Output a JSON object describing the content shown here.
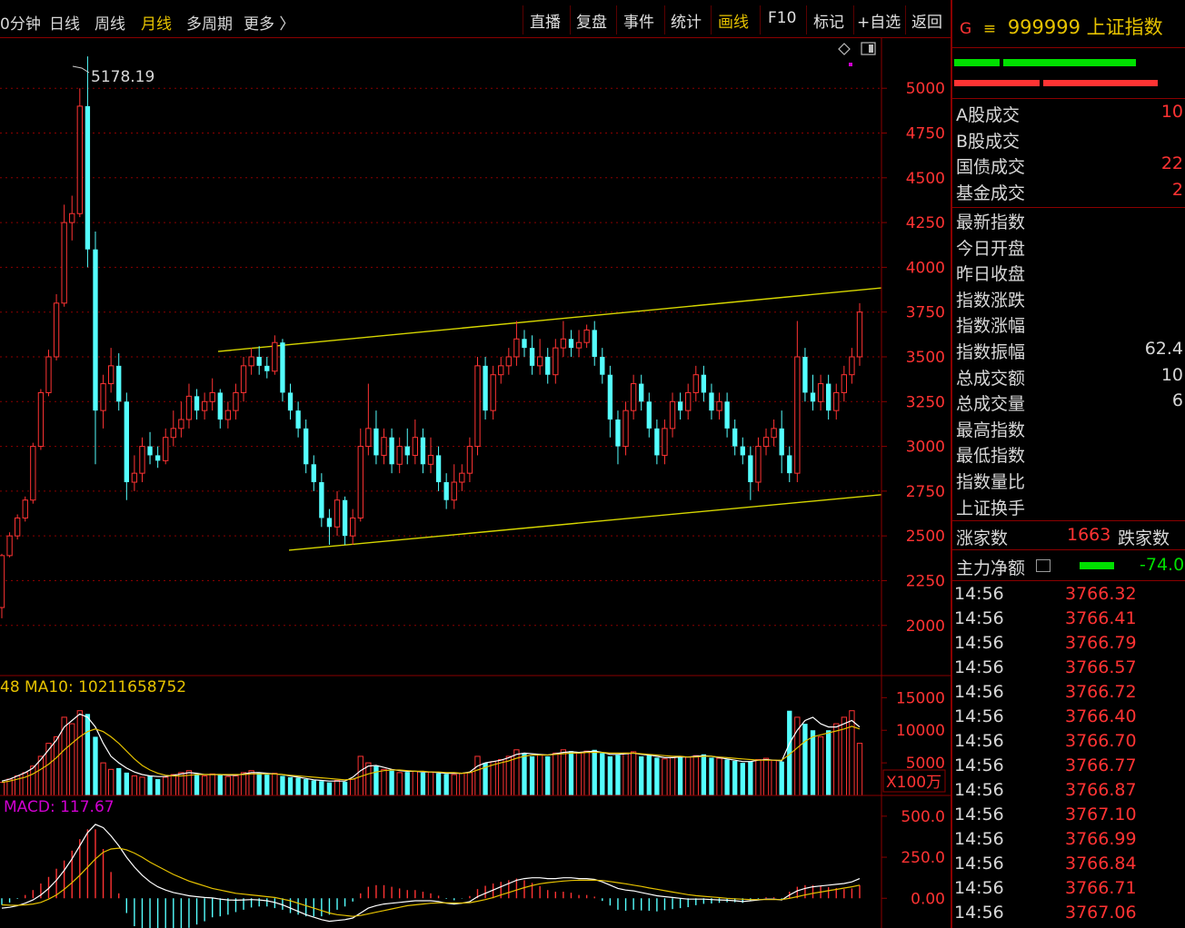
{
  "toolbar": {
    "periods": [
      "0分钟",
      "日线",
      "周线",
      "月线",
      "多周期",
      "更多 〉"
    ],
    "active_period": "月线",
    "tools": [
      "直播",
      "复盘",
      "事件",
      "统计",
      "画线",
      "F10",
      "标记",
      "+自选",
      "返回"
    ],
    "active_tool": "画线"
  },
  "colors": {
    "up": "#ff3333",
    "down": "#54ffff",
    "ma_white": "#ffffff",
    "ma_yellow": "#e6c200",
    "trend": "#d6d600",
    "grid": "#8b0000",
    "macd_label": "#d000d0"
  },
  "chart_data": {
    "type": "candlestick",
    "price_axis": {
      "ticks": [
        5000,
        4750,
        4500,
        4250,
        4000,
        3750,
        3500,
        3250,
        3000,
        2750,
        2500,
        2250,
        2000
      ],
      "range": [
        1730,
        5280
      ]
    },
    "max_label": "5178.19",
    "volume_label": "48  MA10: 10211658752",
    "volume_axis": {
      "ticks": [
        15000,
        10000,
        5000
      ],
      "unit": "X100万",
      "range": [
        0,
        17000
      ]
    },
    "macd_label": "MACD: 117.67",
    "macd_axis": {
      "ticks": [
        "500.0",
        "250.0",
        "0.00"
      ],
      "range": [
        -170,
        560
      ]
    },
    "candles": [
      [
        2100,
        2390,
        2040,
        2400
      ],
      [
        2390,
        2500,
        2380,
        2520
      ],
      [
        2500,
        2600,
        2480,
        2620
      ],
      [
        2600,
        2700,
        2580,
        2720
      ],
      [
        2700,
        3000,
        2680,
        3020
      ],
      [
        3000,
        3300,
        2980,
        3320
      ],
      [
        3300,
        3500,
        3280,
        3540
      ],
      [
        3500,
        3800,
        3480,
        3850
      ],
      [
        3800,
        4250,
        3780,
        4350
      ],
      [
        4250,
        4300,
        4150,
        4400
      ],
      [
        4300,
        4900,
        4280,
        5000
      ],
      [
        4900,
        4100,
        4000,
        5178.19
      ],
      [
        4100,
        3200,
        2900,
        4200
      ],
      [
        3200,
        3350,
        3100,
        3400
      ],
      [
        3350,
        3450,
        3300,
        3550
      ],
      [
        3450,
        3250,
        3200,
        3520
      ],
      [
        3250,
        2800,
        2700,
        3300
      ],
      [
        2800,
        2850,
        2750,
        2950
      ],
      [
        2850,
        3000,
        2800,
        3050
      ],
      [
        3000,
        2950,
        2900,
        3080
      ],
      [
        2950,
        2920,
        2880,
        3000
      ],
      [
        2920,
        3050,
        2900,
        3100
      ],
      [
        3050,
        3100,
        3000,
        3200
      ],
      [
        3100,
        3150,
        3050,
        3250
      ],
      [
        3150,
        3280,
        3100,
        3350
      ],
      [
        3280,
        3200,
        3150,
        3320
      ],
      [
        3200,
        3250,
        3150,
        3300
      ],
      [
        3250,
        3300,
        3200,
        3380
      ],
      [
        3300,
        3150,
        3100,
        3320
      ],
      [
        3150,
        3200,
        3100,
        3250
      ],
      [
        3200,
        3300,
        3150,
        3350
      ],
      [
        3300,
        3450,
        3250,
        3500
      ],
      [
        3450,
        3500,
        3400,
        3550
      ],
      [
        3500,
        3450,
        3400,
        3560
      ],
      [
        3450,
        3420,
        3380,
        3500
      ],
      [
        3420,
        3580,
        3400,
        3620
      ],
      [
        3580,
        3300,
        3250,
        3600
      ],
      [
        3300,
        3200,
        3150,
        3350
      ],
      [
        3200,
        3100,
        3050,
        3250
      ],
      [
        3100,
        2900,
        2850,
        3150
      ],
      [
        2900,
        2800,
        2750,
        2950
      ],
      [
        2800,
        2600,
        2550,
        2850
      ],
      [
        2600,
        2550,
        2450,
        2650
      ],
      [
        2550,
        2700,
        2500,
        2750
      ],
      [
        2700,
        2500,
        2450,
        2720
      ],
      [
        2500,
        2600,
        2450,
        2650
      ],
      [
        2600,
        3000,
        2580,
        3100
      ],
      [
        3000,
        3100,
        2950,
        3350
      ],
      [
        3100,
        2950,
        2900,
        3200
      ],
      [
        2950,
        3050,
        2900,
        3100
      ],
      [
        3050,
        2900,
        2850,
        3100
      ],
      [
        2900,
        3000,
        2850,
        3050
      ],
      [
        3000,
        2950,
        2900,
        3100
      ],
      [
        2950,
        3050,
        2900,
        3150
      ],
      [
        3050,
        2900,
        2850,
        3100
      ],
      [
        2900,
        2950,
        2850,
        3050
      ],
      [
        2950,
        2800,
        2750,
        3000
      ],
      [
        2800,
        2700,
        2650,
        2850
      ],
      [
        2700,
        2800,
        2650,
        2900
      ],
      [
        2800,
        2850,
        2750,
        2900
      ],
      [
        2850,
        3000,
        2800,
        3050
      ],
      [
        3000,
        3450,
        2950,
        3500
      ],
      [
        3450,
        3200,
        3150,
        3500
      ],
      [
        3200,
        3400,
        3150,
        3450
      ],
      [
        3400,
        3450,
        3350,
        3500
      ],
      [
        3450,
        3500,
        3400,
        3550
      ],
      [
        3500,
        3600,
        3450,
        3700
      ],
      [
        3600,
        3550,
        3500,
        3650
      ],
      [
        3550,
        3450,
        3400,
        3620
      ],
      [
        3450,
        3500,
        3400,
        3600
      ],
      [
        3500,
        3400,
        3350,
        3550
      ],
      [
        3400,
        3550,
        3350,
        3600
      ],
      [
        3550,
        3600,
        3500,
        3700
      ],
      [
        3600,
        3550,
        3500,
        3650
      ],
      [
        3550,
        3580,
        3500,
        3650
      ],
      [
        3580,
        3650,
        3550,
        3680
      ],
      [
        3650,
        3500,
        3450,
        3700
      ],
      [
        3500,
        3400,
        3350,
        3550
      ],
      [
        3400,
        3150,
        3050,
        3450
      ],
      [
        3150,
        3000,
        2900,
        3200
      ],
      [
        3000,
        3200,
        2950,
        3250
      ],
      [
        3200,
        3350,
        3150,
        3400
      ],
      [
        3350,
        3250,
        3200,
        3400
      ],
      [
        3250,
        3100,
        3050,
        3300
      ],
      [
        3100,
        2950,
        2900,
        3150
      ],
      [
        2950,
        3100,
        2900,
        3150
      ],
      [
        3100,
        3250,
        3050,
        3300
      ],
      [
        3250,
        3200,
        3150,
        3300
      ],
      [
        3200,
        3300,
        3150,
        3350
      ],
      [
        3300,
        3400,
        3250,
        3450
      ],
      [
        3400,
        3300,
        3250,
        3450
      ],
      [
        3300,
        3200,
        3150,
        3350
      ],
      [
        3200,
        3250,
        3150,
        3300
      ],
      [
        3250,
        3100,
        3050,
        3300
      ],
      [
        3100,
        3000,
        2950,
        3150
      ],
      [
        3000,
        2950,
        2900,
        3050
      ],
      [
        2950,
        2800,
        2700,
        3000
      ],
      [
        2800,
        3000,
        2750,
        3050
      ],
      [
        3000,
        3050,
        2950,
        3100
      ],
      [
        3050,
        3100,
        3000,
        3150
      ],
      [
        3100,
        2950,
        2850,
        3200
      ],
      [
        2950,
        2850,
        2800,
        3000
      ],
      [
        2850,
        3500,
        2800,
        3700
      ],
      [
        3500,
        3300,
        3250,
        3550
      ],
      [
        3300,
        3250,
        3200,
        3400
      ],
      [
        3250,
        3350,
        3200,
        3400
      ],
      [
        3350,
        3200,
        3150,
        3400
      ],
      [
        3200,
        3300,
        3150,
        3350
      ],
      [
        3300,
        3400,
        3250,
        3450
      ],
      [
        3400,
        3500,
        3350,
        3550
      ],
      [
        3500,
        3750,
        3450,
        3800
      ]
    ],
    "volume": [
      2000,
      2500,
      3000,
      3500,
      4500,
      6000,
      8000,
      9000,
      12000,
      11000,
      13000,
      12500,
      9000,
      5000,
      4000,
      4200,
      3500,
      3000,
      2800,
      3000,
      2500,
      2800,
      3200,
      3500,
      3800,
      3300,
      3000,
      3300,
      3200,
      2900,
      3000,
      3500,
      3800,
      3500,
      3200,
      3400,
      3000,
      2800,
      2700,
      2500,
      2300,
      2200,
      2000,
      2300,
      2100,
      2500,
      6000,
      5000,
      4500,
      4000,
      3800,
      3500,
      3600,
      3700,
      3500,
      3600,
      3400,
      3300,
      3200,
      3400,
      3500,
      6000,
      5000,
      5200,
      5500,
      6000,
      7000,
      6500,
      6000,
      6200,
      6000,
      6500,
      7000,
      6800,
      6500,
      6800,
      7000,
      6500,
      6000,
      6200,
      6500,
      6700,
      6000,
      6200,
      5800,
      5600,
      5800,
      6000,
      5900,
      6100,
      6300,
      5800,
      5700,
      5500,
      5300,
      5000,
      5200,
      5500,
      5700,
      5400,
      5200,
      13000,
      12000,
      11000,
      10000,
      9000,
      10000,
      11000,
      12000,
      13000,
      8000
    ],
    "vol_ma_white": [
      2200,
      2500,
      3000,
      3500,
      4200,
      5500,
      7000,
      8500,
      10500,
      11500,
      12500,
      12000,
      10500,
      8000,
      6000,
      5000,
      4200,
      3600,
      3200,
      3000,
      2900,
      2900,
      3100,
      3300,
      3500,
      3400,
      3200,
      3200,
      3200,
      3100,
      3100,
      3300,
      3500,
      3500,
      3400,
      3300,
      3200,
      3000,
      2800,
      2600,
      2400,
      2300,
      2200,
      2200,
      2200,
      2800,
      3800,
      4500,
      4600,
      4300,
      4000,
      3800,
      3700,
      3700,
      3600,
      3600,
      3500,
      3400,
      3400,
      3400,
      3600,
      4500,
      5000,
      5200,
      5400,
      5800,
      6300,
      6500,
      6400,
      6300,
      6200,
      6400,
      6600,
      6700,
      6600,
      6700,
      6800,
      6600,
      6300,
      6300,
      6400,
      6500,
      6300,
      6200,
      6000,
      5800,
      5800,
      5900,
      5900,
      6000,
      6100,
      6000,
      5800,
      5600,
      5400,
      5200,
      5200,
      5400,
      5500,
      5400,
      5300,
      8000,
      10000,
      11500,
      12000,
      11000,
      10500,
      10500,
      11000,
      11500,
      10500
    ],
    "vol_ma_yellow": [
      2000,
      2200,
      2500,
      2800,
      3300,
      4000,
      4800,
      5800,
      7000,
      8000,
      9000,
      9800,
      10200,
      9800,
      9000,
      8000,
      6800,
      5600,
      4600,
      3900,
      3400,
      3100,
      3000,
      3000,
      3100,
      3200,
      3200,
      3200,
      3200,
      3200,
      3200,
      3200,
      3300,
      3300,
      3300,
      3300,
      3200,
      3100,
      3000,
      2900,
      2800,
      2700,
      2600,
      2500,
      2400,
      2500,
      2900,
      3300,
      3600,
      3800,
      3900,
      3900,
      3800,
      3700,
      3700,
      3600,
      3600,
      3500,
      3500,
      3400,
      3500,
      3900,
      4300,
      4700,
      5000,
      5300,
      5700,
      6000,
      6200,
      6200,
      6200,
      6300,
      6400,
      6500,
      6500,
      6600,
      6600,
      6600,
      6500,
      6500,
      6500,
      6500,
      6400,
      6300,
      6200,
      6100,
      6000,
      6000,
      5900,
      5900,
      6000,
      6000,
      5900,
      5800,
      5700,
      5600,
      5500,
      5400,
      5400,
      5400,
      5400,
      6300,
      7300,
      8300,
      9000,
      9300,
      9600,
      9900,
      10200,
      10600,
      10200
    ],
    "macd_dif": [
      -60,
      -55,
      -45,
      -30,
      -10,
      20,
      60,
      110,
      170,
      240,
      320,
      400,
      450,
      430,
      380,
      320,
      250,
      190,
      140,
      100,
      70,
      50,
      35,
      25,
      15,
      10,
      5,
      2,
      -5,
      -10,
      -12,
      -10,
      -8,
      -10,
      -15,
      -25,
      -40,
      -60,
      -80,
      -100,
      -115,
      -130,
      -140,
      -135,
      -130,
      -120,
      -90,
      -60,
      -45,
      -35,
      -30,
      -25,
      -20,
      -15,
      -15,
      -15,
      -20,
      -30,
      -35,
      -30,
      -20,
      10,
      30,
      50,
      70,
      90,
      110,
      120,
      125,
      125,
      120,
      120,
      125,
      125,
      120,
      120,
      115,
      100,
      80,
      60,
      50,
      45,
      35,
      25,
      15,
      10,
      5,
      0,
      -5,
      -5,
      -5,
      -8,
      -10,
      -12,
      -15,
      -20,
      -15,
      -10,
      -5,
      -5,
      -10,
      20,
      45,
      60,
      70,
      75,
      80,
      85,
      90,
      100,
      120
    ],
    "macd_dea": [
      -40,
      -42,
      -43,
      -40,
      -35,
      -25,
      -5,
      20,
      55,
      95,
      140,
      190,
      240,
      280,
      300,
      305,
      295,
      275,
      250,
      220,
      195,
      170,
      145,
      125,
      105,
      90,
      75,
      60,
      50,
      40,
      30,
      25,
      20,
      15,
      10,
      5,
      -5,
      -15,
      -30,
      -45,
      -60,
      -75,
      -90,
      -100,
      -105,
      -110,
      -105,
      -95,
      -85,
      -75,
      -65,
      -55,
      -45,
      -40,
      -35,
      -30,
      -28,
      -28,
      -29,
      -29,
      -27,
      -18,
      -8,
      5,
      20,
      35,
      50,
      65,
      78,
      88,
      95,
      100,
      105,
      108,
      110,
      110,
      110,
      108,
      102,
      95,
      88,
      80,
      72,
      63,
      55,
      46,
      38,
      30,
      22,
      16,
      12,
      8,
      4,
      0,
      -3,
      -6,
      -8,
      -8,
      -8,
      -8,
      -8,
      0,
      10,
      20,
      30,
      38,
      46,
      54,
      62,
      70,
      80
    ]
  },
  "right_panel": {
    "code_marker": "G",
    "menu_icon": "≡",
    "title": "999999 上证指数",
    "rows_a": [
      {
        "label": "A股成交",
        "value": "10"
      },
      {
        "label": "B股成交",
        "value": ""
      },
      {
        "label": "国债成交",
        "value": "22"
      },
      {
        "label": "基金成交",
        "value": "2"
      }
    ],
    "rows_b": [
      {
        "label": "最新指数",
        "value": ""
      },
      {
        "label": "今日开盘",
        "value": ""
      },
      {
        "label": "昨日收盘",
        "value": ""
      },
      {
        "label": "指数涨跌",
        "value": ""
      },
      {
        "label": "指数涨幅",
        "value": ""
      },
      {
        "label": "指数振幅",
        "value": "62.4"
      },
      {
        "label": "总成交额",
        "value": "10"
      },
      {
        "label": "总成交量",
        "value": "6"
      },
      {
        "label": "最高指数",
        "value": ""
      },
      {
        "label": "最低指数",
        "value": ""
      },
      {
        "label": "指数量比",
        "value": ""
      },
      {
        "label": "上证换手",
        "value": ""
      }
    ],
    "breadth": {
      "up_label": "涨家数",
      "up_value": "1663",
      "down_label": "跌家数"
    },
    "main_flow": {
      "label": "主力净额",
      "value": "-74.0"
    },
    "ticks": [
      {
        "time": "14:56",
        "price": "3766.32"
      },
      {
        "time": "14:56",
        "price": "3766.41"
      },
      {
        "time": "14:56",
        "price": "3766.79"
      },
      {
        "time": "14:56",
        "price": "3766.57"
      },
      {
        "time": "14:56",
        "price": "3766.72"
      },
      {
        "time": "14:56",
        "price": "3766.40"
      },
      {
        "time": "14:56",
        "price": "3766.70"
      },
      {
        "time": "14:56",
        "price": "3766.77"
      },
      {
        "time": "14:56",
        "price": "3766.87"
      },
      {
        "time": "14:56",
        "price": "3767.10"
      },
      {
        "time": "14:56",
        "price": "3766.99"
      },
      {
        "time": "14:56",
        "price": "3766.84"
      },
      {
        "time": "14:56",
        "price": "3766.71"
      },
      {
        "time": "14:56",
        "price": "3767.06"
      }
    ]
  }
}
